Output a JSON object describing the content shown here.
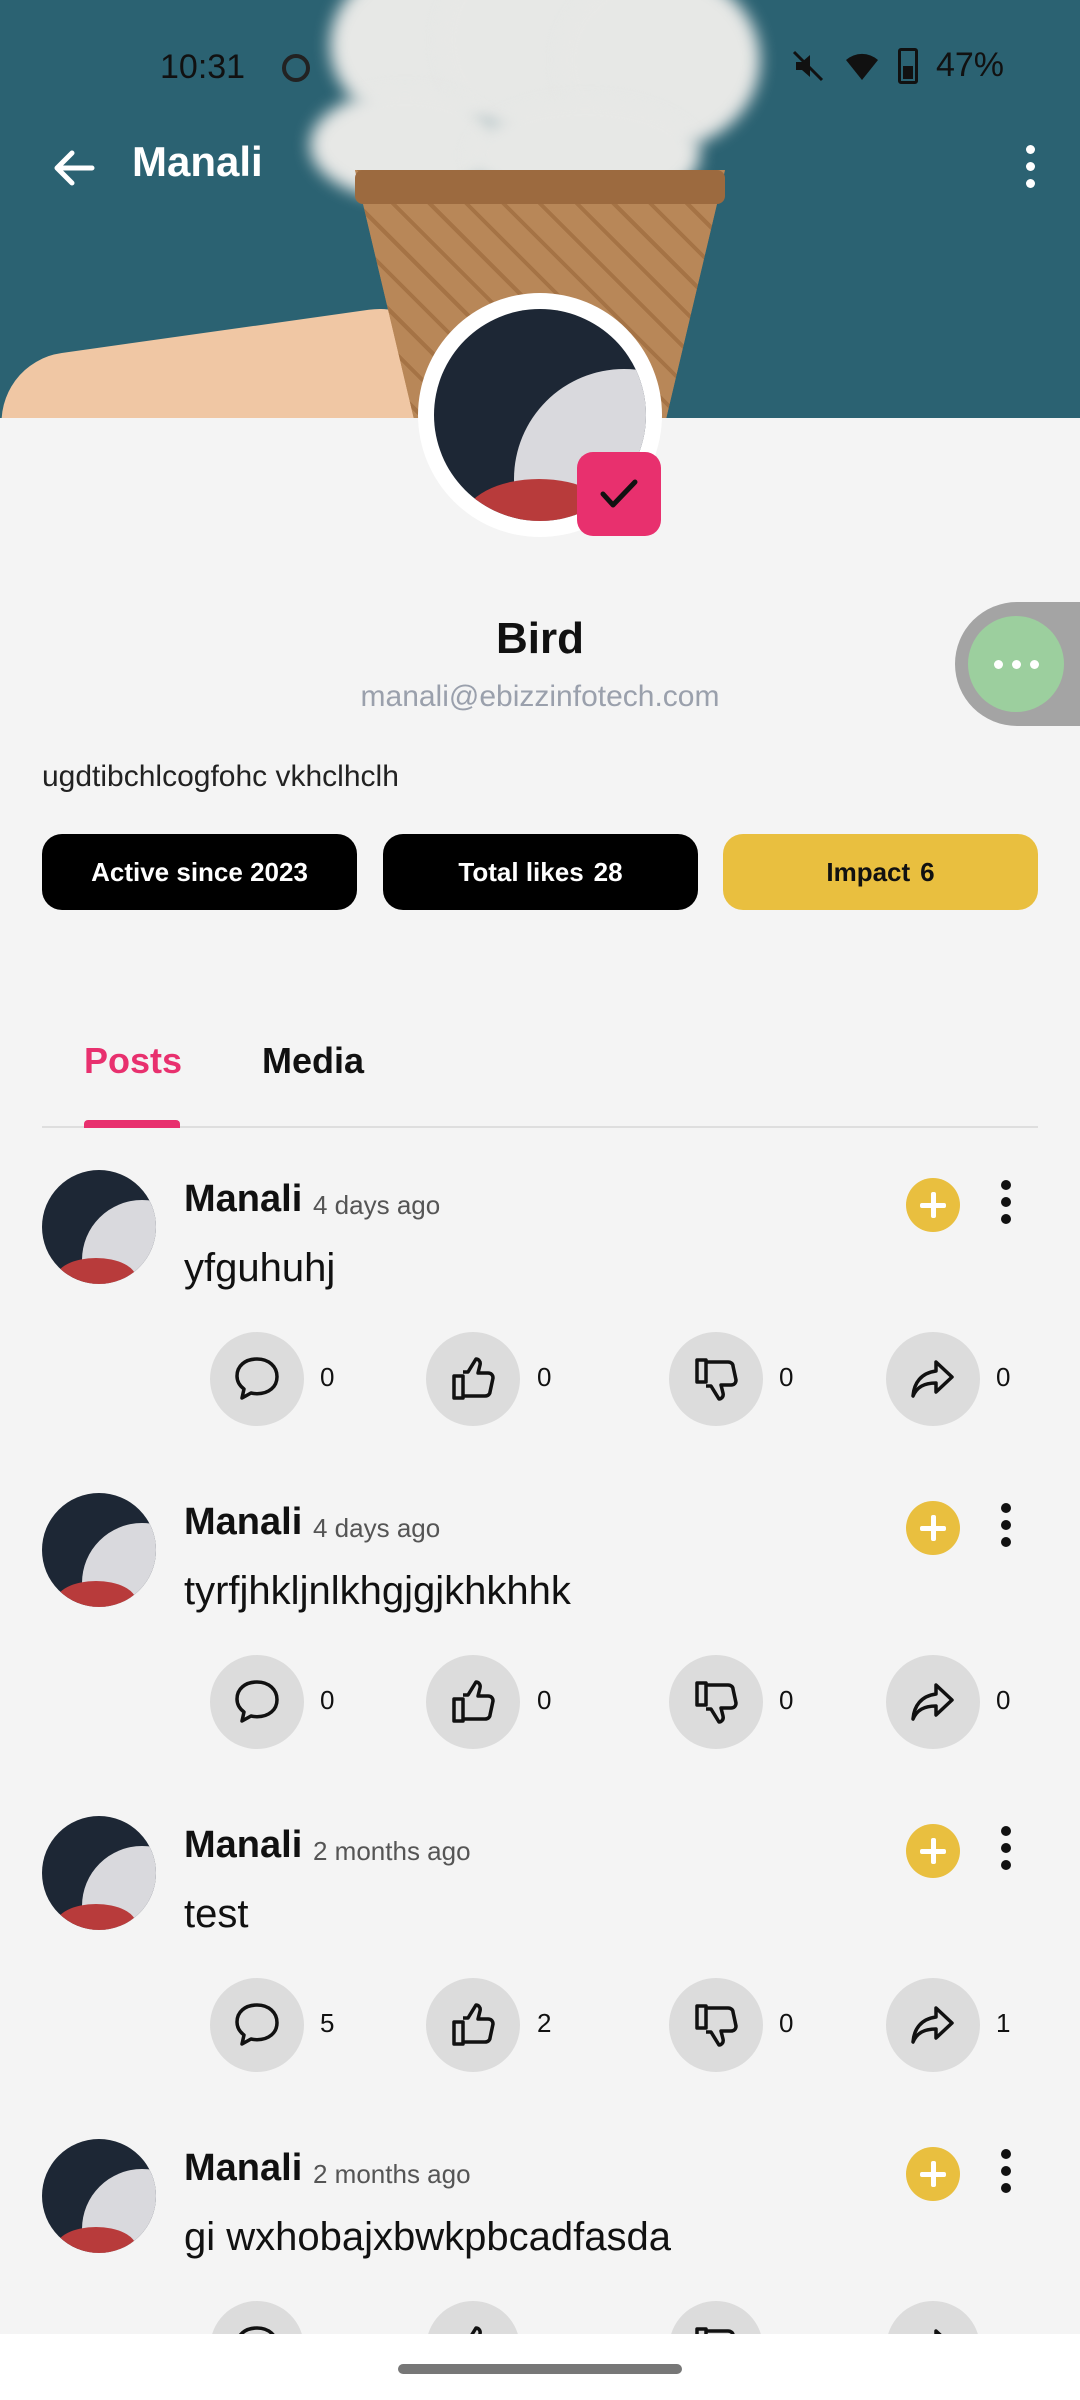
{
  "status_bar": {
    "time": "10:31",
    "battery": "47%"
  },
  "app_bar": {
    "title": "Manali"
  },
  "profile": {
    "name": "Bird",
    "email": "manali@ebizzinfotech.com",
    "bio": "ugdtibchlcogfohc vkhclhclh",
    "chips": {
      "active": "Active since 2023",
      "likes_label": "Total likes",
      "likes_value": "28",
      "impact_label": "Impact",
      "impact_value": "6"
    }
  },
  "tabs": [
    {
      "label": "Posts",
      "active": true
    },
    {
      "label": "Media",
      "active": false
    }
  ],
  "posts": [
    {
      "author": "Manali",
      "time": "4 days ago",
      "text": "yfguhuhj",
      "comments": "0",
      "likes": "0",
      "dislikes": "0",
      "shares": "0"
    },
    {
      "author": "Manali",
      "time": "4 days ago",
      "text": "tyrfjhkljnlkhgjgjkhkhhk",
      "comments": "0",
      "likes": "0",
      "dislikes": "0",
      "shares": "0"
    },
    {
      "author": "Manali",
      "time": "2 months ago",
      "text": "test",
      "comments": "5",
      "likes": "2",
      "dislikes": "0",
      "shares": "1"
    },
    {
      "author": "Manali",
      "time": "2 months ago",
      "text": "gi wxhobajxbwkpbcadfasda",
      "comments": "",
      "likes": "",
      "dislikes": "",
      "shares": ""
    }
  ],
  "colors": {
    "accent": "#e8306e",
    "impact": "#e9bf3f",
    "fab": "#9ccf9e"
  },
  "icons": [
    "arrow-left-icon",
    "more-vertical-icon",
    "check-icon",
    "comment-icon",
    "thumbs-up-icon",
    "thumbs-down-icon",
    "share-icon",
    "plus-icon"
  ]
}
